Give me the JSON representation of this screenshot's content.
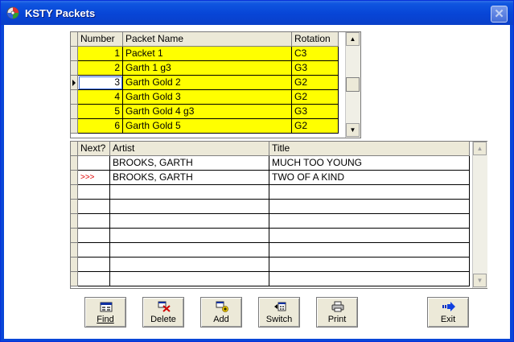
{
  "window": {
    "title": "KSTY Packets"
  },
  "packets": {
    "columns": [
      "Number",
      "Packet Name",
      "Rotation"
    ],
    "rows": [
      {
        "number": "1",
        "name": "Packet 1",
        "rotation": "C3"
      },
      {
        "number": "2",
        "name": "Garth 1 g3",
        "rotation": "G3"
      },
      {
        "number": "3",
        "name": "Garth Gold 2",
        "rotation": "G2"
      },
      {
        "number": "4",
        "name": "Garth Gold 3",
        "rotation": "G2"
      },
      {
        "number": "5",
        "name": "Garth Gold 4 g3",
        "rotation": "G3"
      },
      {
        "number": "6",
        "name": "Garth Gold 5",
        "rotation": "G2"
      }
    ],
    "current_row": 3
  },
  "songs": {
    "columns": [
      "Next?",
      "Artist",
      "Title"
    ],
    "rows": [
      {
        "next": "",
        "artist": "BROOKS, GARTH",
        "title": "MUCH TOO YOUNG"
      },
      {
        "next": ">>>",
        "artist": "BROOKS, GARTH",
        "title": "TWO OF A KIND"
      }
    ]
  },
  "toolbar": {
    "find": "Find",
    "delete": "Delete",
    "add": "Add",
    "switch": "Switch",
    "print": "Print",
    "exit": "Exit"
  },
  "icons": {
    "app": "app-disc-icon",
    "find": "find-icon",
    "delete": "delete-icon",
    "add": "add-icon",
    "switch": "switch-icon",
    "print": "printer-icon",
    "exit": "exit-arrow-icon"
  },
  "colors": {
    "highlight": "#ffff00",
    "next_marker": "#e00000"
  }
}
